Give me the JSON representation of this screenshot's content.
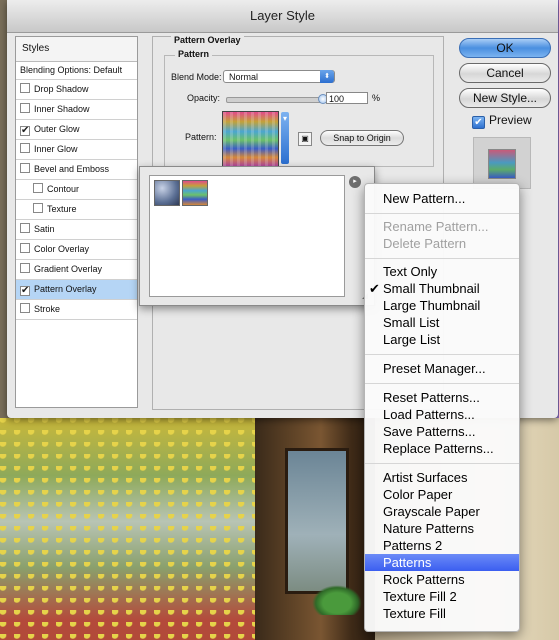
{
  "window": {
    "title": "Layer Style"
  },
  "styles_panel": {
    "header": "Styles",
    "blending_options": "Blending Options: Default",
    "items": [
      {
        "label": "Drop Shadow",
        "checked": false
      },
      {
        "label": "Inner Shadow",
        "checked": false
      },
      {
        "label": "Outer Glow",
        "checked": true
      },
      {
        "label": "Inner Glow",
        "checked": false
      },
      {
        "label": "Bevel and Emboss",
        "checked": false
      },
      {
        "label": "Contour",
        "checked": false
      },
      {
        "label": "Texture",
        "checked": false
      },
      {
        "label": "Satin",
        "checked": false
      },
      {
        "label": "Color Overlay",
        "checked": false
      },
      {
        "label": "Gradient Overlay",
        "checked": false
      },
      {
        "label": "Pattern Overlay",
        "checked": true,
        "selected": true
      },
      {
        "label": "Stroke",
        "checked": false
      }
    ]
  },
  "pattern_overlay": {
    "section_title": "Pattern Overlay",
    "group_title": "Pattern",
    "blend_mode_label": "Blend Mode:",
    "blend_mode_value": "Normal",
    "opacity_label": "Opacity:",
    "opacity_value": "100",
    "opacity_unit": "%",
    "opacity_fraction": 1.0,
    "pattern_label": "Pattern:",
    "snap_button": "Snap to Origin"
  },
  "buttons": {
    "ok": "OK",
    "cancel": "Cancel",
    "new_style": "New Style..."
  },
  "preview": {
    "label": "Preview",
    "checked": true
  },
  "pattern_picker": {
    "thumbnails": [
      "bubbles-pattern",
      "rainbow-pattern"
    ]
  },
  "context_menu": {
    "groups": [
      [
        {
          "label": "New Pattern...",
          "enabled": true
        }
      ],
      [
        {
          "label": "Rename Pattern...",
          "enabled": false
        },
        {
          "label": "Delete Pattern",
          "enabled": false
        }
      ],
      [
        {
          "label": "Text Only"
        },
        {
          "label": "Small Thumbnail",
          "checked": true
        },
        {
          "label": "Large Thumbnail"
        },
        {
          "label": "Small List"
        },
        {
          "label": "Large List"
        }
      ],
      [
        {
          "label": "Preset Manager..."
        }
      ],
      [
        {
          "label": "Reset Patterns..."
        },
        {
          "label": "Load Patterns..."
        },
        {
          "label": "Save Patterns..."
        },
        {
          "label": "Replace Patterns..."
        }
      ],
      [
        {
          "label": "Artist Surfaces"
        },
        {
          "label": "Color Paper"
        },
        {
          "label": "Grayscale Paper"
        },
        {
          "label": "Nature Patterns"
        },
        {
          "label": "Patterns 2"
        },
        {
          "label": "Patterns",
          "highlighted": true
        },
        {
          "label": "Rock Patterns"
        },
        {
          "label": "Texture Fill 2"
        },
        {
          "label": "Texture Fill"
        }
      ]
    ]
  },
  "icons": {
    "check": "✔",
    "menu_arrow": "▸",
    "select_arrows": "⬍"
  }
}
